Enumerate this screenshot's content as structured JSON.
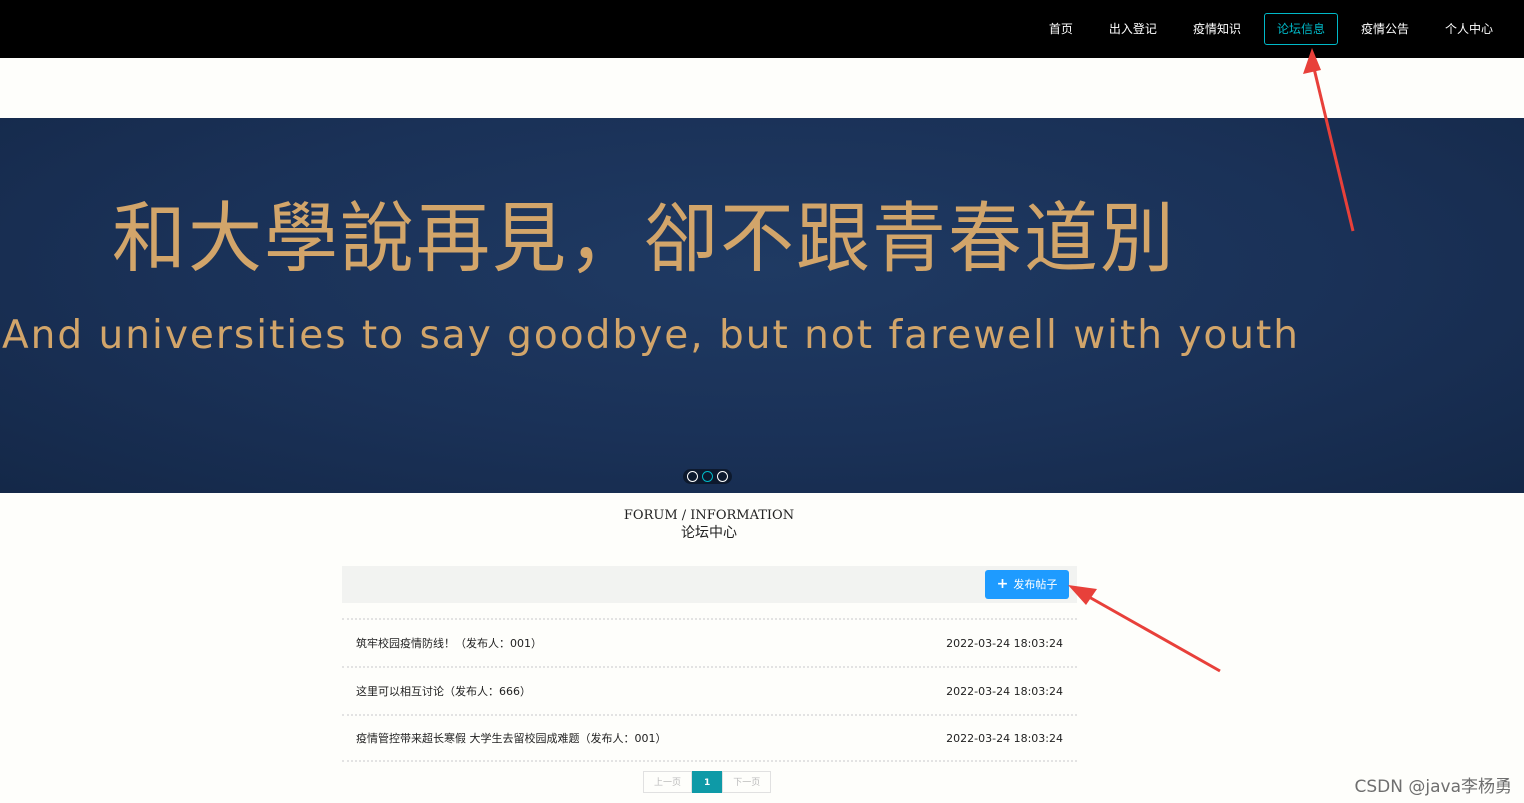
{
  "nav": {
    "items": [
      {
        "label": "首页",
        "active": false
      },
      {
        "label": "出入登记",
        "active": false
      },
      {
        "label": "疫情知识",
        "active": false
      },
      {
        "label": "论坛信息",
        "active": true
      },
      {
        "label": "疫情公告",
        "active": false
      },
      {
        "label": "个人中心",
        "active": false
      }
    ],
    "active_color": "#00b9c8"
  },
  "banner": {
    "headline": "和大學說再見，卻不跟青春道別",
    "subline": "And universities to say goodbye, but not farewell with youth",
    "slide_count": 3,
    "active_slide": 2
  },
  "section": {
    "en_title": "FORUM / INFORMATION",
    "cn_title": "论坛中心"
  },
  "toolbar": {
    "add_label": "发布帖子",
    "add_icon": "plus-icon",
    "button_color": "#1e9bff"
  },
  "posts": [
    {
      "title": "筑牢校园疫情防线！（发布人：001）",
      "time": "2022-03-24 18:03:24"
    },
    {
      "title": "这里可以相互讨论（发布人：666）",
      "time": "2022-03-24 18:03:24"
    },
    {
      "title": "疫情管控带来超长寒假 大学生去留校园成难题（发布人：001）",
      "time": "2022-03-24 18:03:24"
    }
  ],
  "pager": {
    "prev": "上一页",
    "current": "1",
    "next": "下一页"
  },
  "watermark": "CSDN @java李杨勇",
  "annotation_color": "#e8403a"
}
